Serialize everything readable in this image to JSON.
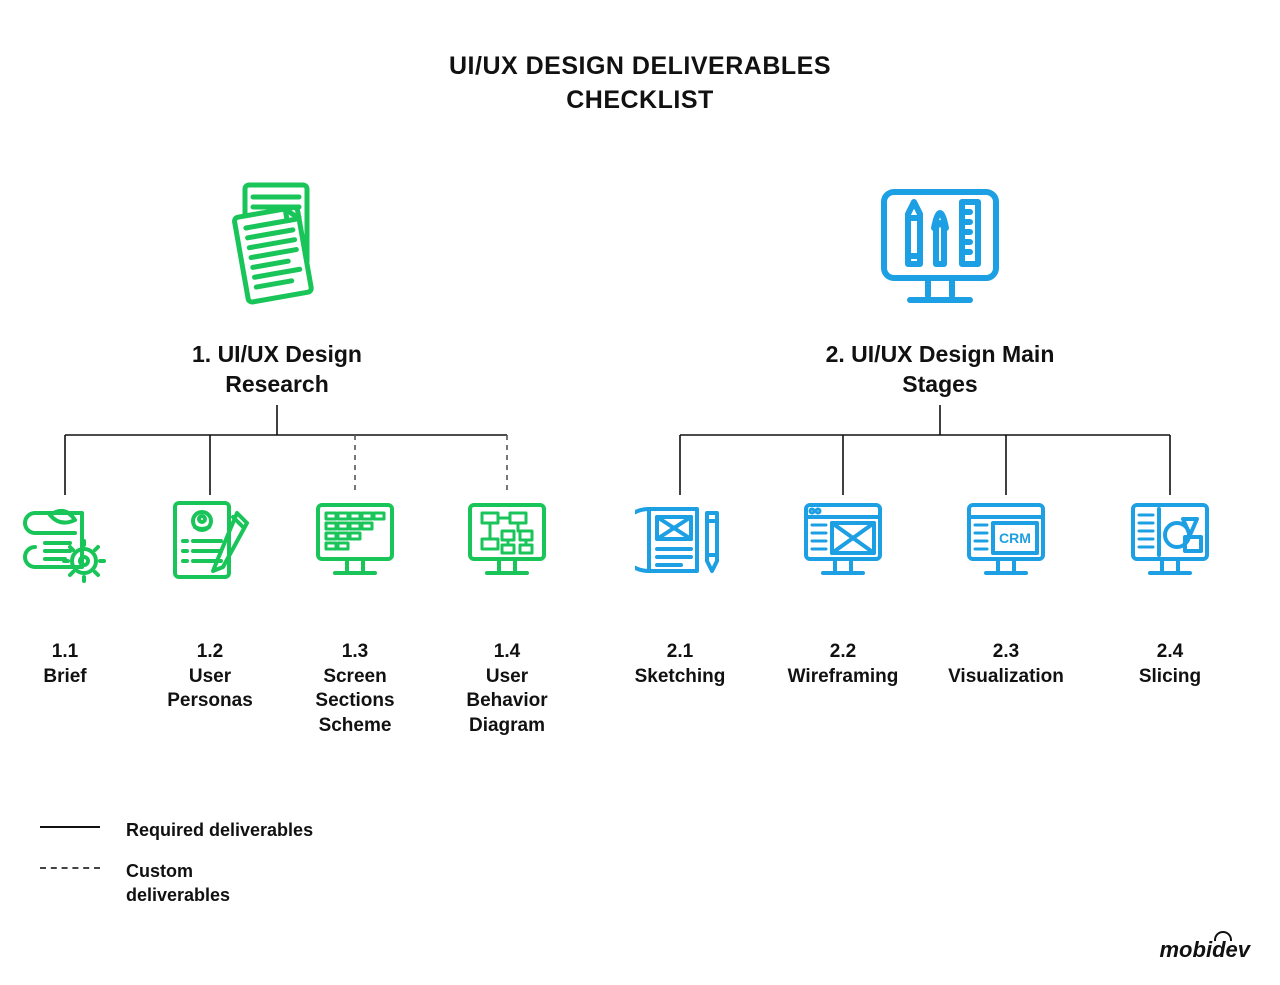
{
  "title": {
    "line1": "UI/UX DESIGN DELIVERABLES",
    "line2": "CHECKLIST"
  },
  "colors": {
    "green": "#19c558",
    "blue": "#1d9fe3",
    "ink": "#111111",
    "dash": "#555555"
  },
  "sections": [
    {
      "key": "research",
      "heading_l1": "1. UI/UX Design",
      "heading_l2": "Research",
      "color": "green",
      "children": [
        {
          "num": "1.1",
          "label": "Brief",
          "icon": "brief-gear-icon",
          "connector": "solid"
        },
        {
          "num": "1.2",
          "label": "User\nPersonas",
          "icon": "persona-doc-icon",
          "connector": "solid"
        },
        {
          "num": "1.3",
          "label": "Screen\nSections\nScheme",
          "icon": "screen-sections-icon",
          "connector": "dashed"
        },
        {
          "num": "1.4",
          "label": "User\nBehavior\nDiagram",
          "icon": "behavior-diagram-icon",
          "connector": "dashed"
        }
      ]
    },
    {
      "key": "main",
      "heading_l1": "2. UI/UX Design Main",
      "heading_l2": "Stages",
      "color": "blue",
      "children": [
        {
          "num": "2.1",
          "label": "Sketching",
          "icon": "sketching-icon",
          "connector": "solid"
        },
        {
          "num": "2.2",
          "label": "Wireframing",
          "icon": "wireframe-icon",
          "connector": "solid"
        },
        {
          "num": "2.3",
          "label": "Visualization",
          "icon": "visualization-icon",
          "connector": "solid"
        },
        {
          "num": "2.4",
          "label": "Slicing",
          "icon": "slicing-icon",
          "connector": "solid"
        }
      ]
    }
  ],
  "legend": {
    "required": "Required deliverables",
    "custom": "Custom deliverables"
  },
  "brand": "mobidev"
}
